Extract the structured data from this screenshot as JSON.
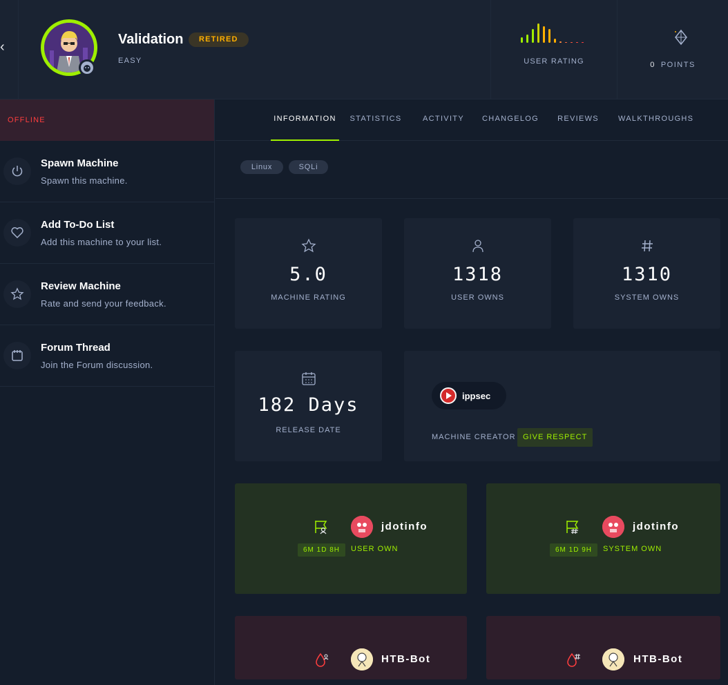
{
  "machine": {
    "name": "Validation",
    "status_badge": "RETIRED",
    "difficulty": "EASY",
    "user_rating_label": "USER RATING",
    "points_value": "0",
    "points_label": "POINTS"
  },
  "sidebar": {
    "status": "OFFLINE",
    "items": [
      {
        "title": "Spawn Machine",
        "subtitle": "Spawn this machine.",
        "icon": "power-icon"
      },
      {
        "title": "Add To-Do List",
        "subtitle": "Add this machine to your list.",
        "icon": "heart-icon"
      },
      {
        "title": "Review Machine",
        "subtitle": "Rate and send your feedback.",
        "icon": "star-icon"
      },
      {
        "title": "Forum Thread",
        "subtitle": "Join the Forum discussion.",
        "icon": "forum-icon"
      }
    ]
  },
  "tabs": [
    "INFORMATION",
    "STATISTICS",
    "ACTIVITY",
    "CHANGELOG",
    "REVIEWS",
    "WALKTHROUGHS"
  ],
  "active_tab": "INFORMATION",
  "tags": [
    "Linux",
    "SQLi"
  ],
  "stats": {
    "rating": {
      "value": "5.0",
      "label": "MACHINE RATING"
    },
    "user_owns": {
      "value": "1318",
      "label": "USER OWNS"
    },
    "system_owns": {
      "value": "1310",
      "label": "SYSTEM OWNS"
    },
    "release": {
      "value": "182 Days",
      "label": "RELEASE DATE"
    }
  },
  "creator": {
    "name": "ippsec",
    "label": "MACHINE CREATOR",
    "respect_button": "GIVE RESPECT"
  },
  "bloods": [
    {
      "user": "jdotinfo",
      "time": "6M 1D 8H",
      "type": "USER OWN"
    },
    {
      "user": "jdotinfo",
      "time": "6M 1D 9H",
      "type": "SYSTEM OWN"
    },
    {
      "user": "HTB-Bot"
    },
    {
      "user": "HTB-Bot"
    }
  ],
  "colors": {
    "accent": "#9fef00",
    "retired": "#ffaf00",
    "offline": "#ff3e3e",
    "background": "#141d2b",
    "card": "#1a2332"
  }
}
